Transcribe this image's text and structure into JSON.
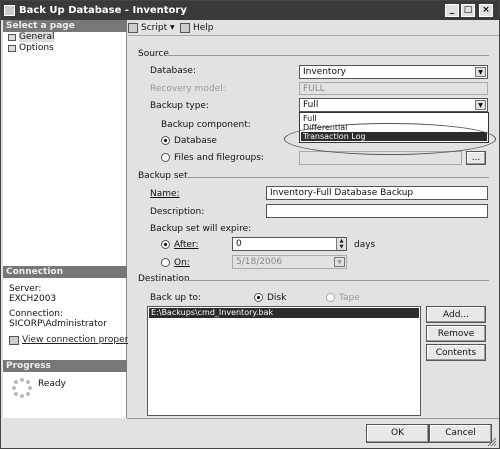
{
  "window": {
    "title": "Back Up Database - Inventory",
    "min": "_",
    "max": "□",
    "close": "×"
  },
  "left": {
    "select_page": "Select a page",
    "pages": [
      "General",
      "Options"
    ],
    "connection_header": "Connection",
    "server_label": "Server:",
    "server_value": "EXCH2003",
    "connection_label": "Connection:",
    "connection_value": "SICORP\\Administrator",
    "view_link": "View connection properties",
    "progress_header": "Progress",
    "progress_status": "Ready"
  },
  "toolbar": {
    "script": "Script",
    "help": "Help"
  },
  "source": {
    "header": "Source",
    "database_label": "Database:",
    "database_value": "Inventory",
    "recovery_label": "Recovery model:",
    "recovery_value": "FULL",
    "backup_type_label": "Backup type:",
    "backup_type_value": "Full",
    "backup_type_options": [
      "Full",
      "Differential",
      "Transaction Log"
    ],
    "component_label": "Backup component:",
    "component_database": "Database",
    "component_files": "Files and filegroups:",
    "browse": "..."
  },
  "backup_set": {
    "header": "Backup set",
    "name_label": "Name:",
    "name_value": "Inventory-Full Database Backup",
    "description_label": "Description:",
    "description_value": "",
    "expire_label": "Backup set will expire:",
    "after_label": "After:",
    "after_value": "0",
    "days": "days",
    "on_label": "On:",
    "on_value": "5/18/2006"
  },
  "destination": {
    "header": "Destination",
    "backup_to_label": "Back up to:",
    "disk": "Disk",
    "tape": "Tape",
    "files": [
      "E:\\Backups\\cmd_Inventory.bak"
    ],
    "add": "Add...",
    "remove": "Remove",
    "contents": "Contents"
  },
  "footer": {
    "ok": "OK",
    "cancel": "Cancel"
  }
}
